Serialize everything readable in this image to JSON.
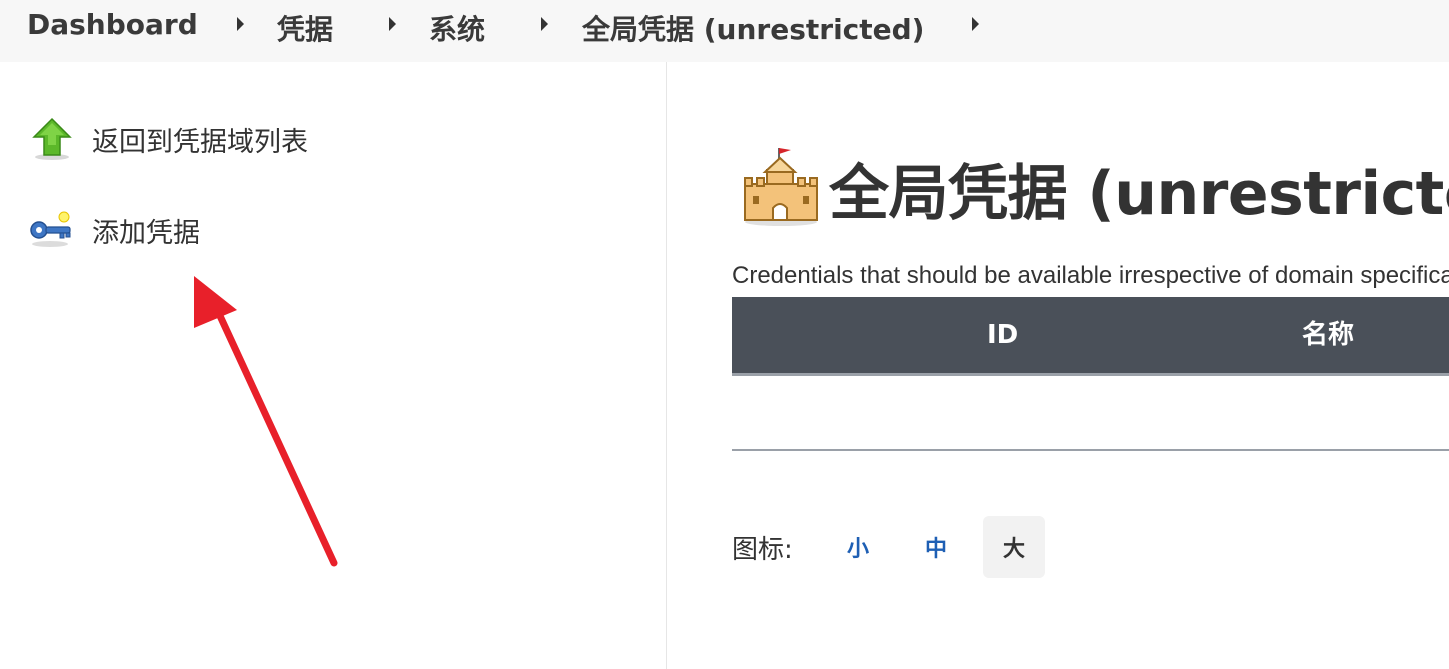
{
  "breadcrumb": {
    "items": [
      "Dashboard",
      "凭据",
      "系统",
      "全局凭据 (unrestricted)"
    ]
  },
  "sidebar": {
    "items": [
      {
        "label": "返回到凭据域列表",
        "icon": "up-arrow-icon"
      },
      {
        "label": "添加凭据",
        "icon": "key-icon"
      }
    ]
  },
  "main": {
    "title": "全局凭据 (unrestricted)",
    "title_icon": "castle-icon",
    "description": "Credentials that should be available irrespective of domain specification to requirements matching.",
    "table": {
      "columns": [
        "ID",
        "名称"
      ]
    },
    "icon_size": {
      "label": "图标:",
      "options": [
        "小",
        "中",
        "大"
      ],
      "selected": "大"
    }
  },
  "colors": {
    "table_header": "#4a5059",
    "link": "#1e5fb4",
    "annotation_arrow": "#e8202a"
  }
}
